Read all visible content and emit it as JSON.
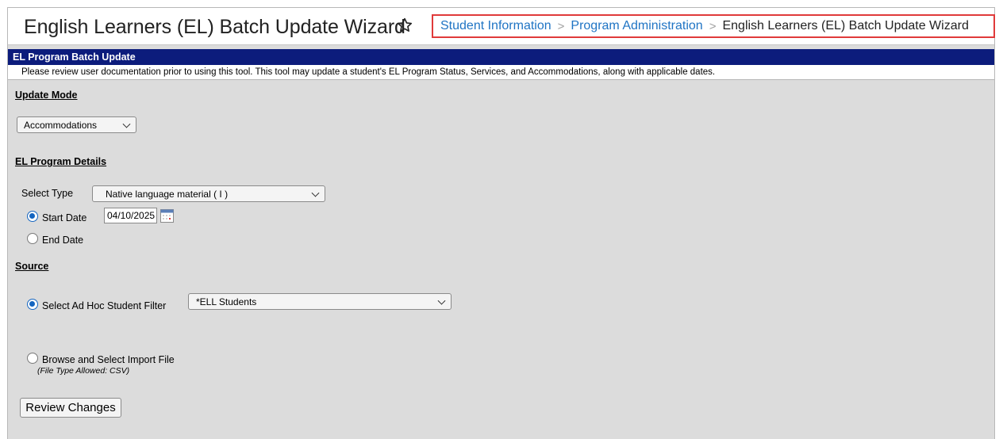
{
  "header": {
    "title": "English Learners (EL) Batch Update Wizard",
    "breadcrumb": [
      "Student Information",
      "Program Administration",
      "English Learners (EL) Batch Update Wizard"
    ]
  },
  "panel": {
    "title": "EL Program Batch Update",
    "notice": "Please review user documentation prior to using this tool. This tool may update a student's EL Program Status, Services, and Accommodations, along with applicable dates."
  },
  "update_mode": {
    "label": "Update Mode",
    "selected": "Accommodations"
  },
  "program_details": {
    "label": "EL Program Details",
    "select_type_label": "Select Type",
    "select_type_value": "Native language material ( I )",
    "start_date_label": "Start Date",
    "start_date_value": "04/10/2025",
    "end_date_label": "End Date"
  },
  "source": {
    "label": "Source",
    "adhoc_label": "Select Ad Hoc Student Filter",
    "adhoc_value": "*ELL Students",
    "import_label": "Browse and Select Import File",
    "import_hint": "(File Type Allowed: CSV)"
  },
  "actions": {
    "review_label": "Review Changes"
  },
  "colors": {
    "header_bar": "#0c1c7c",
    "link": "#1f74c4",
    "highlight_border": "#e03a3a",
    "radio_selected": "#1565c0",
    "background": "#dcdcdc"
  }
}
